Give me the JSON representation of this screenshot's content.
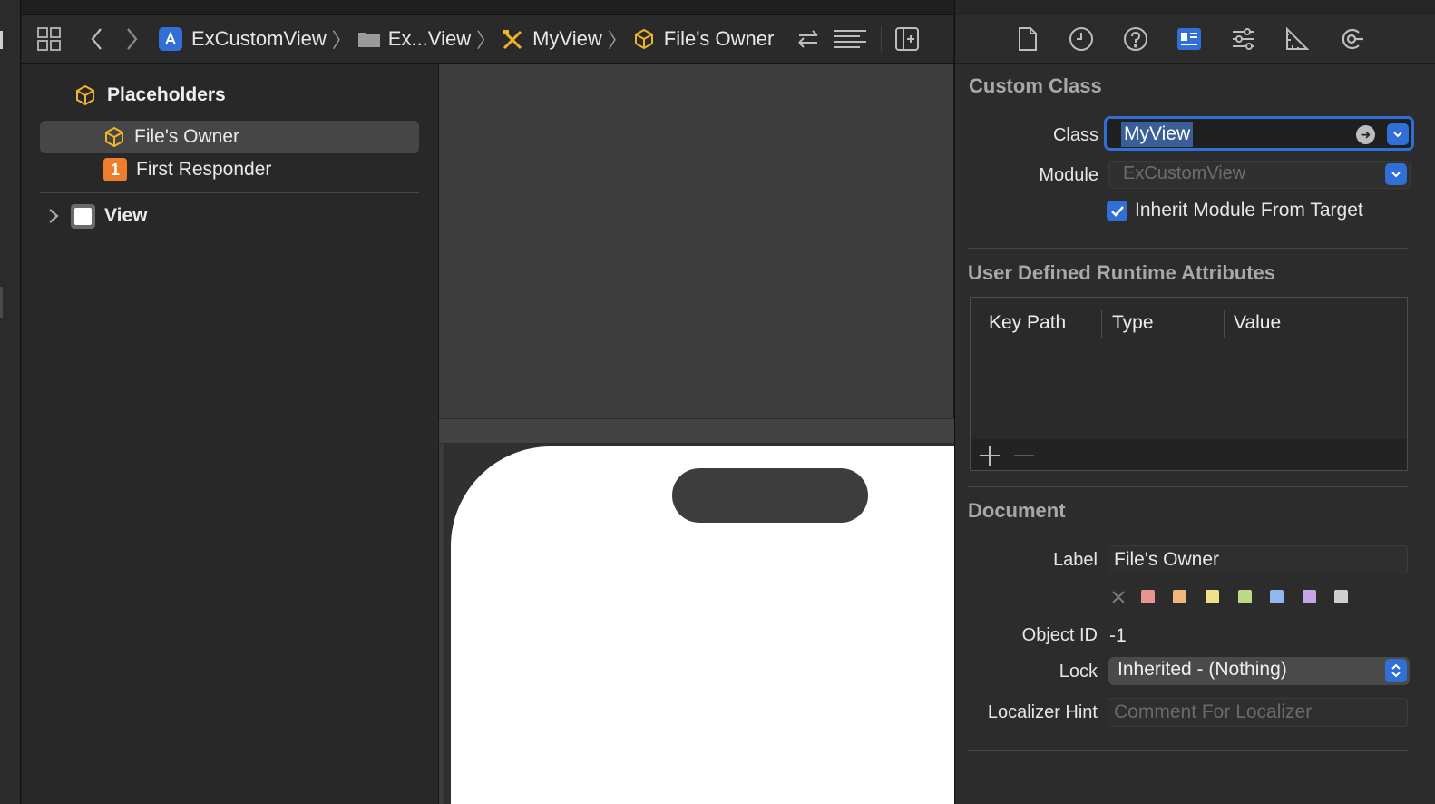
{
  "breadcrumb": {
    "project": "ExCustomView",
    "group": "Ex...View",
    "file": "MyView",
    "object": "File's Owner"
  },
  "outline": {
    "section_title": "Placeholders",
    "items": [
      {
        "label": "File's Owner",
        "selected": true
      },
      {
        "label": "First Responder",
        "badge": "1"
      }
    ],
    "view_label": "View"
  },
  "inspector": {
    "tabs": [
      "file-inspector",
      "history-inspector",
      "quick-help",
      "identity-inspector",
      "attributes-inspector",
      "size-inspector",
      "connections-inspector"
    ],
    "active_tab": "identity-inspector",
    "custom_class": {
      "title": "Custom Class",
      "class_label": "Class",
      "class_value": "MyView",
      "module_label": "Module",
      "module_placeholder": "ExCustomView",
      "inherit_label": "Inherit Module From Target",
      "inherit_checked": true
    },
    "runtime_attributes": {
      "title": "User Defined Runtime Attributes",
      "columns": [
        "Key Path",
        "Type",
        "Value"
      ],
      "rows": []
    },
    "document": {
      "title": "Document",
      "label_label": "Label",
      "label_value": "File's Owner",
      "label_colors": [
        "#e8948f",
        "#f0b77a",
        "#efe08a",
        "#bcd98a",
        "#8fb8ee",
        "#c8a6e6",
        "#cfcfcf"
      ],
      "object_id_label": "Object ID",
      "object_id_value": "-1",
      "lock_label": "Lock",
      "lock_value": "Inherited - (Nothing)",
      "localizer_label": "Localizer Hint",
      "localizer_placeholder": "Comment For Localizer"
    }
  },
  "colors": {
    "accent": "#2f6fd6",
    "placeholder_cube": "#f0b429",
    "first_responder": "#ef7d2d"
  }
}
